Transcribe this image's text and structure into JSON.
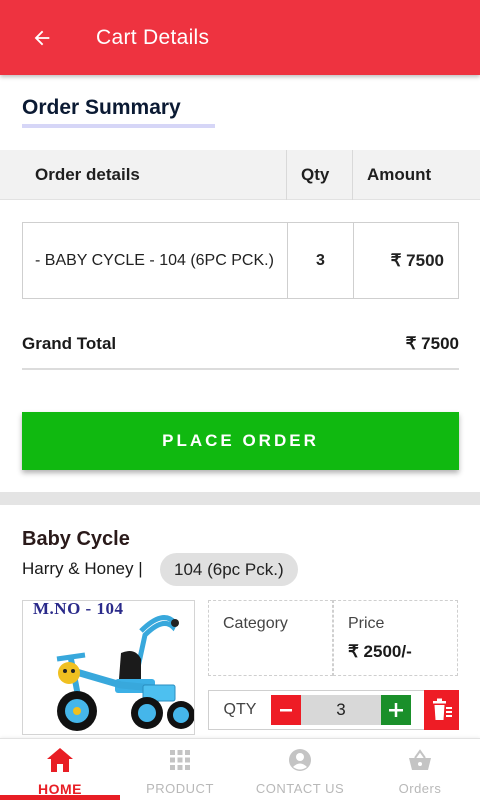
{
  "header": {
    "title": "Cart Details",
    "background": "#ee3340"
  },
  "summary": {
    "title": "Order Summary",
    "columns": [
      "Order details",
      "Qty",
      "Amount"
    ],
    "rows": [
      {
        "details": "- BABY CYCLE - 104 (6PC PCK.)",
        "qty": "3",
        "amount": "₹ 7500"
      }
    ],
    "grand_total_label": "Grand Total",
    "grand_total_value": "₹ 7500",
    "place_order_label": "PLACE ORDER",
    "place_order_color": "#10b910"
  },
  "product": {
    "name": "Baby Cycle",
    "brand": "Harry & Honey |",
    "model": "104 (6pc Pck.)",
    "image_caption": "M.NO - 104",
    "category_label": "Category",
    "category_value": "",
    "price_label": "Price",
    "price_value": "₹ 2500/-",
    "qty_label": "QTY",
    "qty_value": "3"
  },
  "bottom_nav": {
    "items": [
      {
        "label": "HOME",
        "icon": "home-icon",
        "active": true
      },
      {
        "label": "PRODUCT",
        "icon": "grid-icon",
        "active": false
      },
      {
        "label": "CONTACT US",
        "icon": "user-circle-icon",
        "active": false
      },
      {
        "label": "Orders",
        "icon": "basket-icon",
        "active": false
      }
    ],
    "active_color": "#e81e25"
  }
}
